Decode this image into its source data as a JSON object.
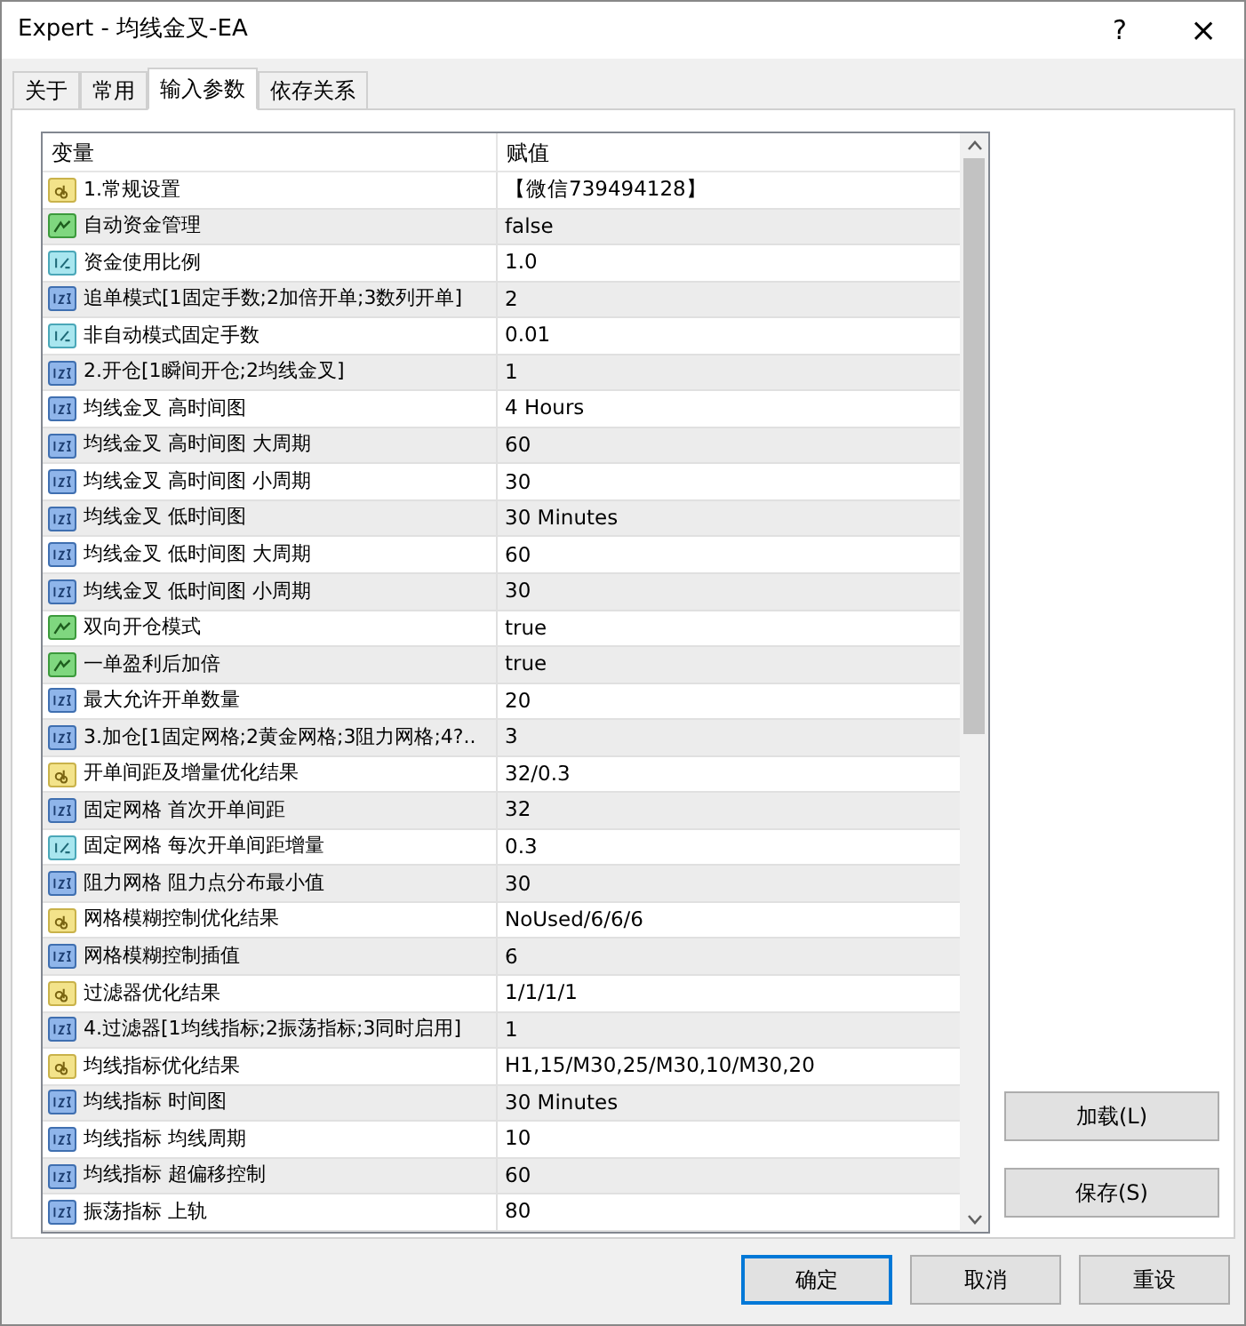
{
  "window": {
    "title": "Expert - 均线金叉-EA",
    "help": "?",
    "close": "×"
  },
  "tabs": [
    {
      "label": "关于",
      "selected": false
    },
    {
      "label": "常用",
      "selected": false
    },
    {
      "label": "输入参数",
      "selected": true
    },
    {
      "label": "依存关系",
      "selected": false
    }
  ],
  "table": {
    "columns": [
      "变量",
      "赋值"
    ],
    "rows": [
      {
        "kind": "string",
        "name": "1.常规设置",
        "value": "【微信739494128】"
      },
      {
        "kind": "bool",
        "name": "自动资金管理",
        "value": "false"
      },
      {
        "kind": "double",
        "name": "资金使用比例",
        "value": "1.0"
      },
      {
        "kind": "int",
        "name": "追单模式[1固定手数;2加倍开单;3数列开单]",
        "value": "2"
      },
      {
        "kind": "double",
        "name": "非自动模式固定手数",
        "value": "0.01"
      },
      {
        "kind": "int",
        "name": "2.开仓[1瞬间开仓;2均线金叉]",
        "value": "1"
      },
      {
        "kind": "int",
        "name": "均线金叉 高时间图",
        "value": "4 Hours"
      },
      {
        "kind": "int",
        "name": "均线金叉 高时间图 大周期",
        "value": "60"
      },
      {
        "kind": "int",
        "name": "均线金叉 高时间图 小周期",
        "value": "30"
      },
      {
        "kind": "int",
        "name": "均线金叉 低时间图",
        "value": "30 Minutes"
      },
      {
        "kind": "int",
        "name": "均线金叉 低时间图 大周期",
        "value": "60"
      },
      {
        "kind": "int",
        "name": "均线金叉 低时间图 小周期",
        "value": "30"
      },
      {
        "kind": "bool",
        "name": "双向开仓模式",
        "value": "true"
      },
      {
        "kind": "bool",
        "name": "一单盈利后加倍",
        "value": "true"
      },
      {
        "kind": "int",
        "name": "最大允许开单数量",
        "value": "20"
      },
      {
        "kind": "int",
        "name": "3.加仓[1固定网格;2黄金网格;3阻力网格;4?..",
        "value": "3"
      },
      {
        "kind": "string",
        "name": "开单间距及增量优化结果",
        "value": "32/0.3"
      },
      {
        "kind": "int",
        "name": "固定网格 首次开单间距",
        "value": "32"
      },
      {
        "kind": "double",
        "name": "固定网格 每次开单间距增量",
        "value": "0.3"
      },
      {
        "kind": "int",
        "name": "阻力网格 阻力点分布最小值",
        "value": "30"
      },
      {
        "kind": "string",
        "name": "网格模糊控制优化结果",
        "value": "NoUsed/6/6/6"
      },
      {
        "kind": "int",
        "name": "网格模糊控制插值",
        "value": "6"
      },
      {
        "kind": "string",
        "name": "过滤器优化结果",
        "value": "1/1/1/1"
      },
      {
        "kind": "int",
        "name": "4.过滤器[1均线指标;2振荡指标;3同时启用]",
        "value": "1"
      },
      {
        "kind": "string",
        "name": "均线指标优化结果",
        "value": "H1,15/M30,25/M30,10/M30,20"
      },
      {
        "kind": "int",
        "name": "均线指标 时间图",
        "value": "30 Minutes"
      },
      {
        "kind": "int",
        "name": "均线指标 均线周期",
        "value": "10"
      },
      {
        "kind": "int",
        "name": "均线指标 超偏移控制",
        "value": "60"
      },
      {
        "kind": "int",
        "name": "振荡指标 上轨",
        "value": "80"
      }
    ]
  },
  "side_buttons": [
    "加载(L)",
    "保存(S)"
  ],
  "buttons": [
    {
      "label": "确定",
      "default": true
    },
    {
      "label": "取消",
      "default": false
    },
    {
      "label": "重设",
      "default": false
    }
  ]
}
